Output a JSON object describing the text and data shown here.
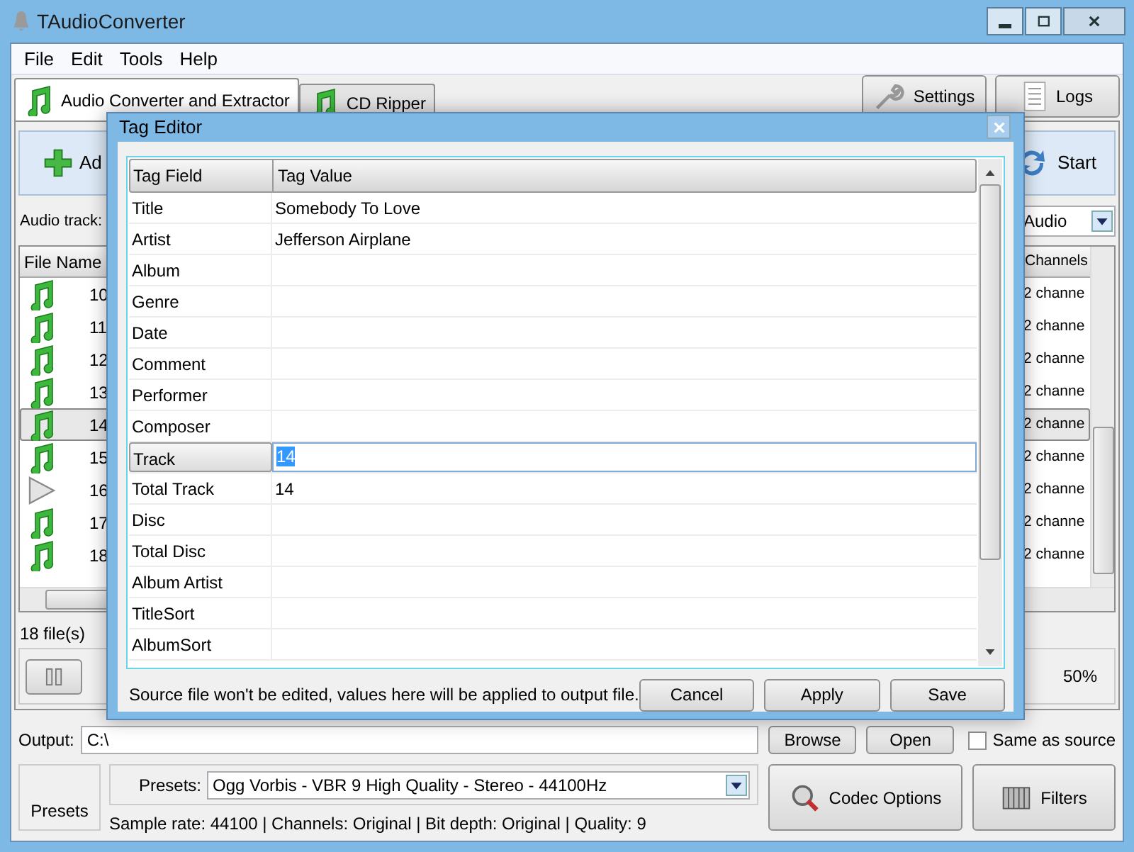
{
  "window": {
    "title": "TAudioConverter"
  },
  "menu": [
    "File",
    "Edit",
    "Tools",
    "Help"
  ],
  "tabs": [
    {
      "label": "Audio Converter and Extractor",
      "selected": true
    },
    {
      "label": "CD Ripper",
      "selected": false
    }
  ],
  "top_buttons": [
    "Settings",
    "Logs"
  ],
  "toolbar": {
    "add_label": "Ad",
    "start_label": "Start"
  },
  "audio_track": {
    "label": "Audio track:",
    "value": "Audio"
  },
  "file_list": {
    "columns": [
      "File Name",
      "Channels"
    ],
    "rows": [
      {
        "kind": "audio",
        "number": "10",
        "channels": "2 channe",
        "selected": false
      },
      {
        "kind": "audio",
        "number": "11",
        "channels": "2 channe",
        "selected": false
      },
      {
        "kind": "audio",
        "number": "12",
        "channels": "2 channe",
        "selected": false
      },
      {
        "kind": "audio",
        "number": "13",
        "channels": "2 channe",
        "selected": false
      },
      {
        "kind": "audio",
        "number": "14",
        "channels": "2 channe",
        "selected": true
      },
      {
        "kind": "audio",
        "number": "15",
        "channels": "2 channe",
        "selected": false
      },
      {
        "kind": "video",
        "number": "16",
        "channels": "2 channe",
        "selected": false
      },
      {
        "kind": "audio",
        "number": "17",
        "channels": "2 channe",
        "selected": false
      },
      {
        "kind": "audio",
        "number": "18",
        "channels": "2 channe",
        "selected": false
      }
    ]
  },
  "file_count": "18 file(s)",
  "progress": {
    "reading": "50%"
  },
  "output": {
    "label": "Output:",
    "value": "C:\\",
    "buttons": [
      "Browse",
      "Open"
    ],
    "same_as_source": {
      "label": "Same as source",
      "checked": false
    }
  },
  "presets": {
    "button": "Presets",
    "label": "Presets:",
    "value": "Ogg Vorbis - VBR 9 High Quality - Stereo - 44100Hz",
    "info": "Sample rate: 44100 | Channels: Original | Bit depth: Original | Quality: 9"
  },
  "action_buttons": [
    {
      "kind": "codec",
      "label": "Codec Options"
    },
    {
      "kind": "filters",
      "label": "Filters"
    }
  ],
  "dialog": {
    "title": "Tag Editor",
    "columns": [
      "Tag Field",
      "Tag Value"
    ],
    "rows": [
      {
        "field": "Title",
        "value": "Somebody To Love",
        "editing": false
      },
      {
        "field": "Artist",
        "value": "Jefferson Airplane",
        "editing": false
      },
      {
        "field": "Album",
        "editing": false
      },
      {
        "field": "Genre",
        "editing": false
      },
      {
        "field": "Date",
        "editing": false
      },
      {
        "field": "Comment",
        "editing": false
      },
      {
        "field": "Performer",
        "editing": false
      },
      {
        "field": "Composer",
        "editing": false
      },
      {
        "field": "Track",
        "value": "14",
        "editing": true
      },
      {
        "field": "Total Track",
        "value": "14",
        "editing": false
      },
      {
        "field": "Disc",
        "editing": false
      },
      {
        "field": "Total Disc",
        "editing": false
      },
      {
        "field": "Album Artist",
        "editing": false
      },
      {
        "field": "TitleSort",
        "editing": false
      },
      {
        "field": "AlbumSort",
        "editing": false
      }
    ],
    "note": "Source file won't be edited, values here will be applied to output file.",
    "buttons": [
      "Cancel",
      "Apply",
      "Save"
    ]
  }
}
